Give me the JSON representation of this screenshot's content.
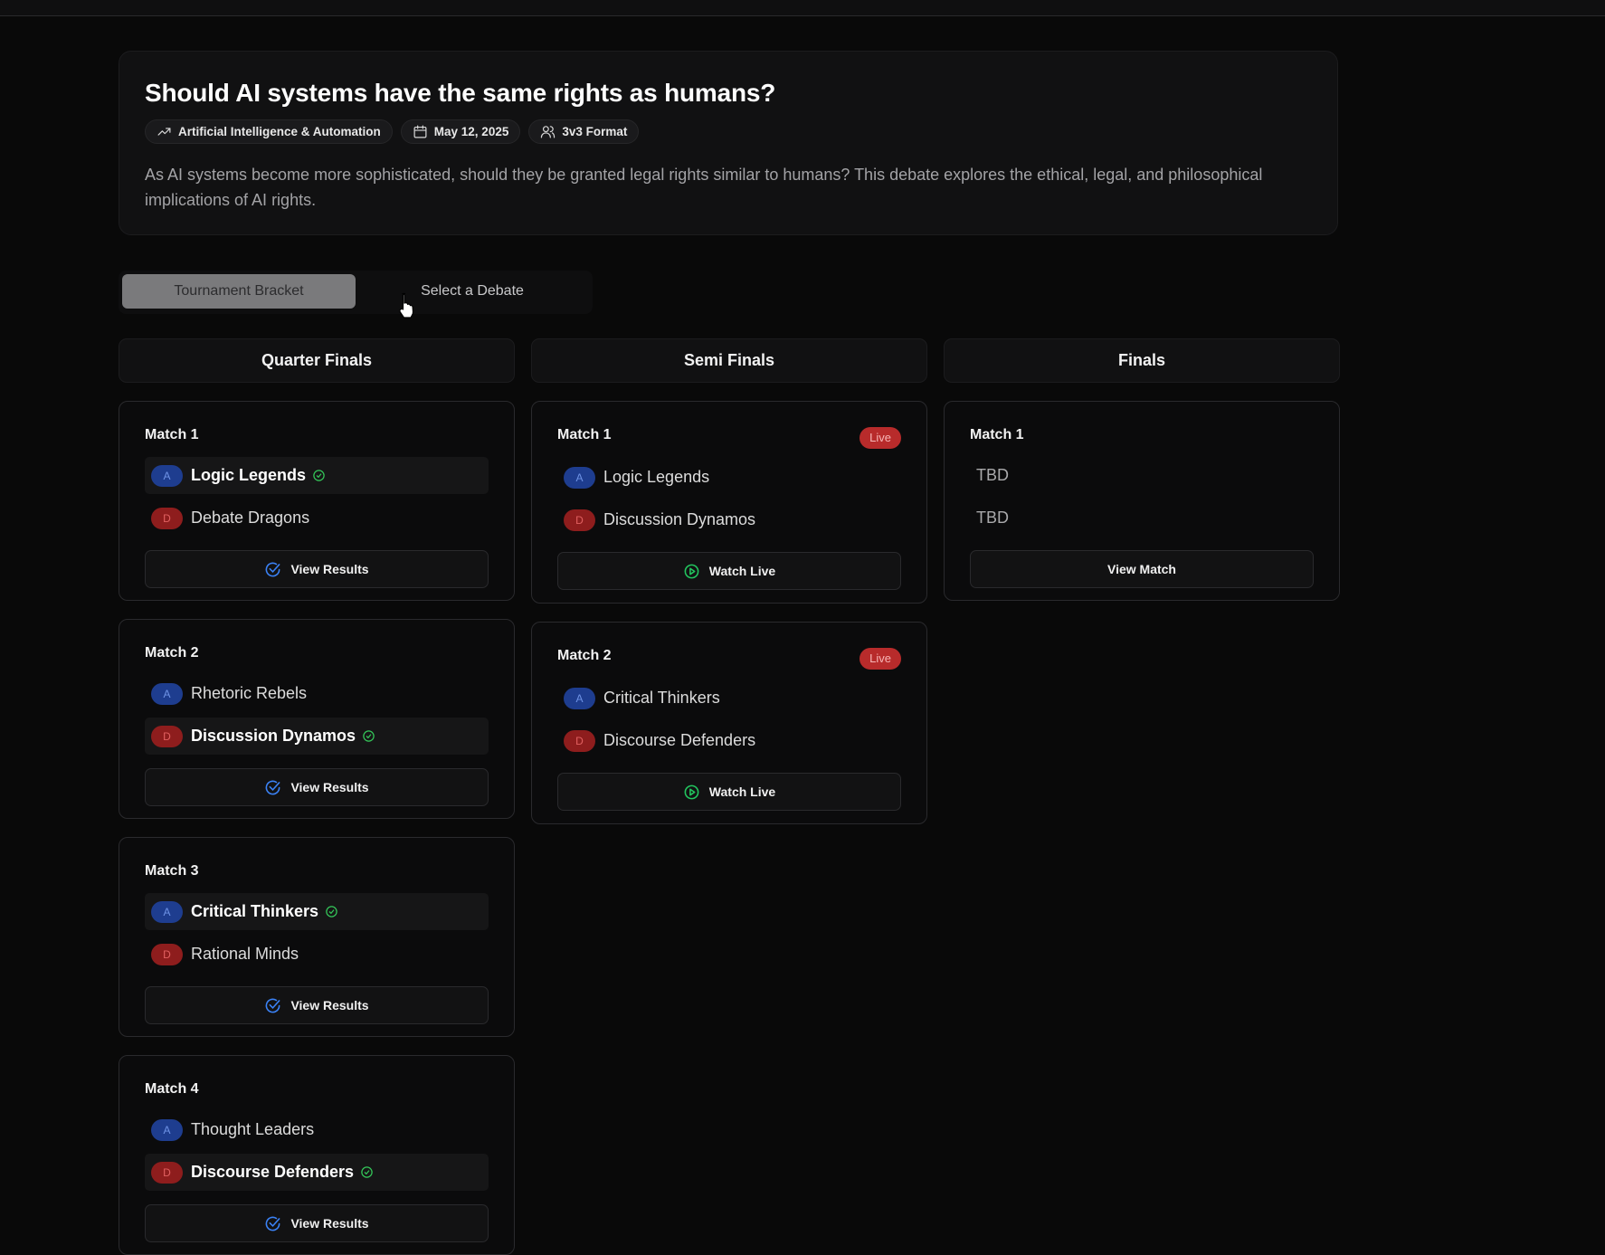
{
  "header": {
    "title": "Should AI systems have the same rights as humans?",
    "category": "Artificial Intelligence & Automation",
    "date": "May 12, 2025",
    "format": "3v3 Format",
    "description": "As AI systems become more sophisticated, should they be granted legal rights similar to humans? This debate explores the ethical, legal, and philosophical implications of AI rights."
  },
  "tabs": {
    "bracket": "Tournament Bracket",
    "select": "Select a Debate",
    "active": "bracket"
  },
  "badges": {
    "a": "A",
    "d": "D",
    "live": "Live"
  },
  "buttons": {
    "view_results": "View Results",
    "watch_live": "Watch Live",
    "view_match": "View Match"
  },
  "colors": {
    "team_a": "#1e3d8f",
    "team_d": "#8e1d1d",
    "live": "#b82b2b",
    "win_check": "#34c759",
    "results_check": "#3b82f6",
    "live_play": "#22c55e"
  },
  "rounds": {
    "quarter": {
      "name": "Quarter Finals",
      "matches": [
        {
          "title": "Match 1",
          "team_a": "Logic Legends",
          "team_d": "Debate Dragons",
          "winner": "a",
          "status": "completed"
        },
        {
          "title": "Match 2",
          "team_a": "Rhetoric Rebels",
          "team_d": "Discussion Dynamos",
          "winner": "d",
          "status": "completed"
        },
        {
          "title": "Match 3",
          "team_a": "Critical Thinkers",
          "team_d": "Rational Minds",
          "winner": "a",
          "status": "completed"
        },
        {
          "title": "Match 4",
          "team_a": "Thought Leaders",
          "team_d": "Discourse Defenders",
          "winner": "d",
          "status": "completed"
        }
      ]
    },
    "semi": {
      "name": "Semi Finals",
      "matches": [
        {
          "title": "Match 1",
          "team_a": "Logic Legends",
          "team_d": "Discussion Dynamos",
          "status": "live"
        },
        {
          "title": "Match 2",
          "team_a": "Critical Thinkers",
          "team_d": "Discourse Defenders",
          "status": "live"
        }
      ]
    },
    "finals": {
      "name": "Finals",
      "matches": [
        {
          "title": "Match 1",
          "team_1": "TBD",
          "team_2": "TBD",
          "status": "pending"
        }
      ]
    }
  }
}
